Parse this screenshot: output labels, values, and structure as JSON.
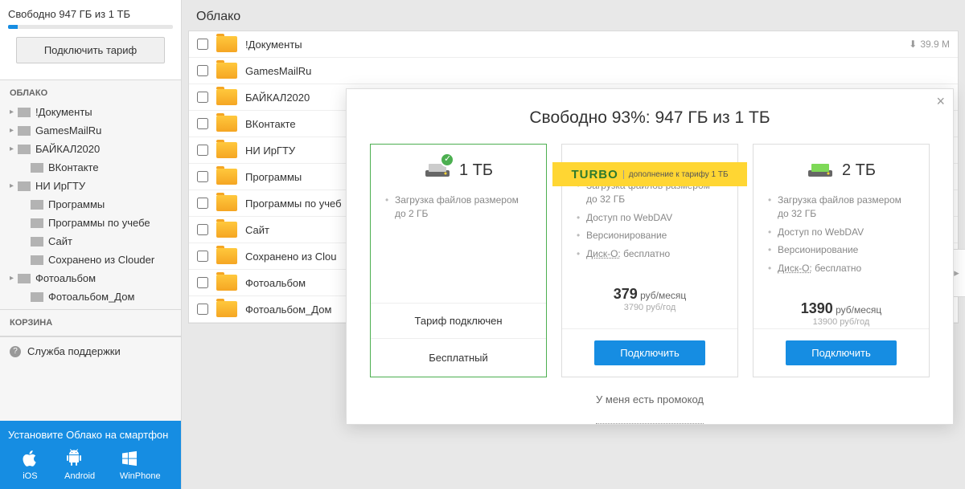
{
  "storage": {
    "text": "Свободно 947 ГБ из 1 ТБ",
    "button": "Подключить тариф"
  },
  "nav": {
    "cloud_header": "ОБЛАКО",
    "items": [
      {
        "label": "!Документы",
        "expandable": true,
        "indent": false
      },
      {
        "label": "GamesMailRu",
        "expandable": true,
        "indent": false
      },
      {
        "label": "БАЙКАЛ2020",
        "expandable": true,
        "indent": false
      },
      {
        "label": "ВКонтакте",
        "expandable": false,
        "indent": true
      },
      {
        "label": "НИ ИрГТУ",
        "expandable": true,
        "indent": false
      },
      {
        "label": "Программы",
        "expandable": false,
        "indent": true
      },
      {
        "label": "Программы по учебе",
        "expandable": false,
        "indent": true
      },
      {
        "label": "Сайт",
        "expandable": false,
        "indent": true
      },
      {
        "label": "Сохранено из Clouder",
        "expandable": false,
        "indent": true
      },
      {
        "label": "Фотоальбом",
        "expandable": true,
        "indent": false
      },
      {
        "label": "Фотоальбом_Дом",
        "expandable": false,
        "indent": true
      }
    ],
    "trash_header": "КОРЗИНА",
    "support": "Служба поддержки"
  },
  "promo": {
    "header": "Установите Облако на смартфон",
    "ios": "iOS",
    "android": "Android",
    "winphone": "WinPhone"
  },
  "breadcrumb": "Облако",
  "files": [
    {
      "name": "!Документы",
      "size": "39.9 М"
    },
    {
      "name": "GamesMailRu"
    },
    {
      "name": "БАЙКАЛ2020"
    },
    {
      "name": "ВКонтакте"
    },
    {
      "name": "НИ ИрГТУ"
    },
    {
      "name": "Программы"
    },
    {
      "name": "Программы по учеб"
    },
    {
      "name": "Сайт"
    },
    {
      "name": "Сохранено из Clou"
    },
    {
      "name": "Фотоальбом"
    },
    {
      "name": "Фотоальбом_Дом"
    }
  ],
  "modal": {
    "title": "Свободно 93%: 947 ГБ из 1 ТБ",
    "plans": [
      {
        "size": "1 ТБ",
        "features": [
          "Загрузка файлов размером до 2 ГБ"
        ],
        "status": "Тариф подключен",
        "free_label": "Бесплатный"
      },
      {
        "turbo": "TURBO",
        "turbo_sub": "дополнение к тарифу 1 ТБ",
        "features": [
          "Загрузка файлов размером до 32 ГБ",
          "Доступ по WebDAV",
          "Версионирование"
        ],
        "disk_o": "Диск-О:",
        "disk_free": " бесплатно",
        "price": "379",
        "price_unit": " руб/месяц",
        "price_year": "3790 руб/год",
        "button": "Подключить"
      },
      {
        "size": "2 ТБ",
        "features": [
          "Загрузка файлов размером до 32 ГБ",
          "Доступ по WebDAV",
          "Версионирование"
        ],
        "disk_o": "Диск-О:",
        "disk_free": " бесплатно",
        "price": "1390",
        "price_unit": " руб/месяц",
        "price_year": "13900 руб/год",
        "button": "Подключить"
      }
    ],
    "promo_link": "У меня есть промокод"
  }
}
